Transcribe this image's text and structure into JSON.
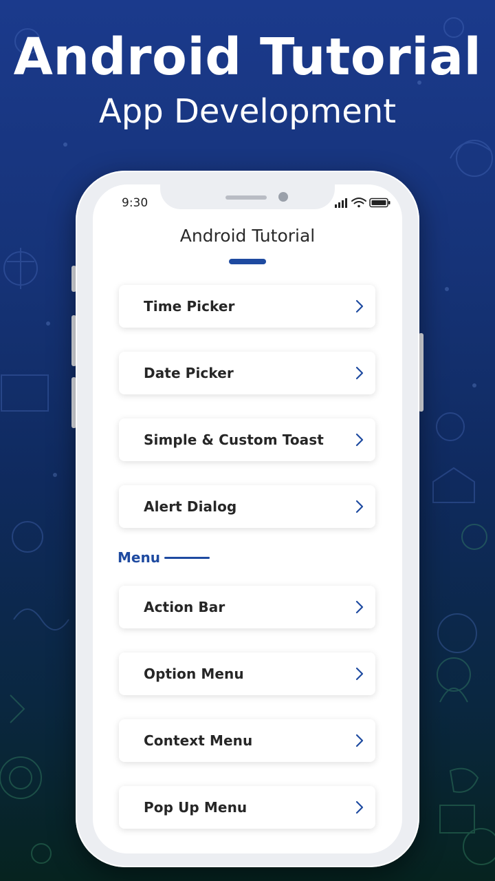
{
  "promo": {
    "title": "Android Tutorial",
    "subtitle": "App Development"
  },
  "status_bar": {
    "time": "9:30",
    "icons": [
      "signal-icon",
      "wifi-icon",
      "battery-icon"
    ]
  },
  "app": {
    "title": "Android Tutorial",
    "accent_color": "#1e4aa0"
  },
  "items": [
    {
      "label": "Time Picker"
    },
    {
      "label": "Date Picker"
    },
    {
      "label": "Simple & Custom Toast"
    },
    {
      "label": "Alert Dialog"
    }
  ],
  "menu_section": {
    "title": "Menu",
    "items": [
      {
        "label": "Action Bar"
      },
      {
        "label": "Option Menu"
      },
      {
        "label": "Context Menu"
      },
      {
        "label": "Pop Up Menu"
      }
    ]
  }
}
